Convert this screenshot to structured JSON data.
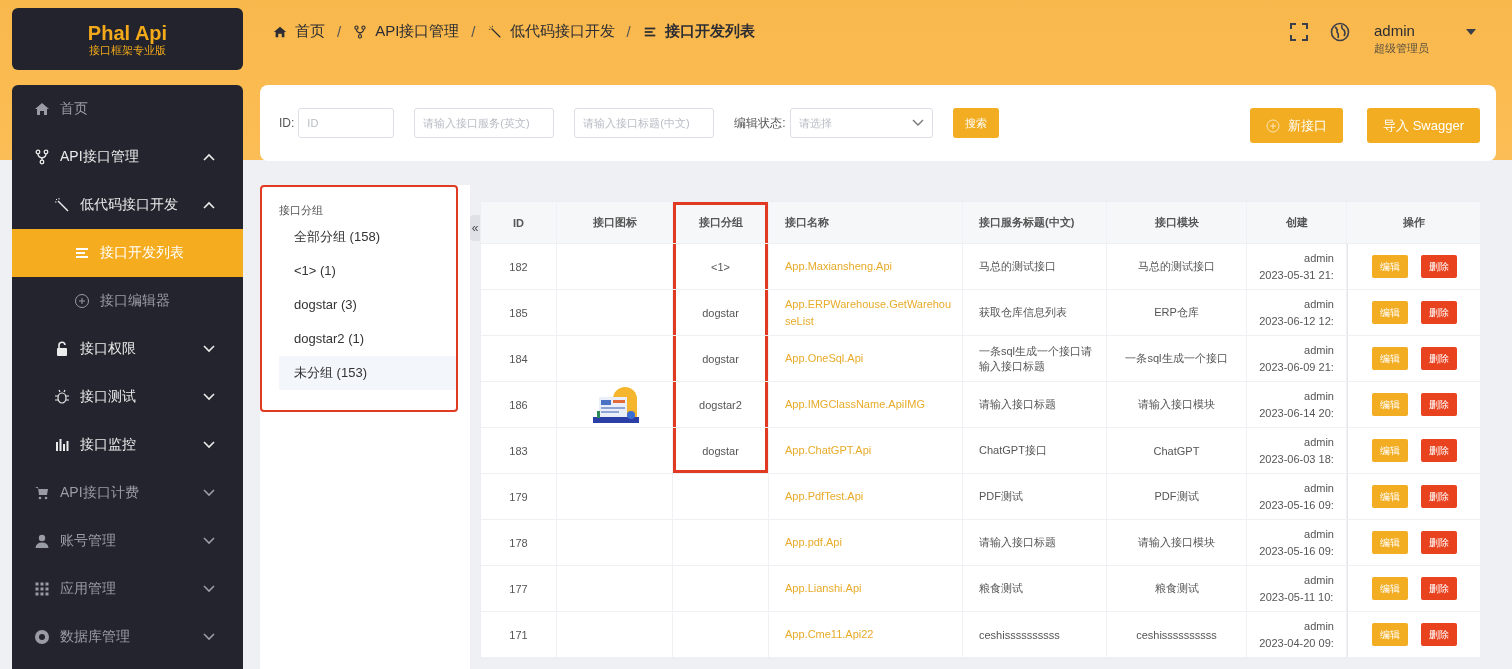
{
  "logo": {
    "name": "Phal Api",
    "tagline": "接口框架专业版"
  },
  "breadcrumb": [
    {
      "label": "首页",
      "current": false
    },
    {
      "label": "API接口管理",
      "current": false
    },
    {
      "label": "低代码接口开发",
      "current": false
    },
    {
      "label": "接口开发列表",
      "current": true
    }
  ],
  "breadcrumb_separator": "/",
  "user": {
    "name": "admin",
    "role": "超级管理员"
  },
  "sidebar": {
    "items": [
      {
        "label": "首页"
      },
      {
        "label": "API接口管理",
        "expanded": true,
        "children": [
          {
            "label": "低代码接口开发",
            "expanded": true,
            "children": [
              {
                "label": "接口开发列表",
                "selected": true
              },
              {
                "label": "接口编辑器",
                "selected": false
              }
            ]
          },
          {
            "label": "接口权限",
            "expanded": false
          },
          {
            "label": "接口测试",
            "expanded": false
          },
          {
            "label": "接口监控",
            "expanded": false
          }
        ]
      },
      {
        "label": "API接口计费",
        "expanded": false
      },
      {
        "label": "账号管理",
        "expanded": false
      },
      {
        "label": "应用管理",
        "expanded": false
      },
      {
        "label": "数据库管理",
        "expanded": false
      }
    ]
  },
  "filters": {
    "id_label": "ID:",
    "id_placeholder": "ID",
    "service_placeholder": "请输入接口服务(英文)",
    "title_placeholder": "请输入接口标题(中文)",
    "status_label": "编辑状态:",
    "status_placeholder": "请选择",
    "search_button": "搜索",
    "new_button": "新接口",
    "import_button": "导入 Swagger"
  },
  "group_panel": {
    "title": "接口分组",
    "highlighted": true,
    "items": [
      {
        "label": "全部分组 (158)",
        "selected": false
      },
      {
        "label": "<1> (1)",
        "selected": false
      },
      {
        "label": "dogstar (3)",
        "selected": false
      },
      {
        "label": "dogstar2 (1)",
        "selected": false
      },
      {
        "label": "未分组 (153)",
        "selected": true
      }
    ]
  },
  "collapse_handle": "«",
  "table": {
    "columns": [
      "ID",
      "接口图标",
      "接口分组",
      "接口名称",
      "接口服务标题(中文)",
      "接口模块",
      "创建",
      "操作"
    ],
    "group_column_highlighted": true,
    "rows": [
      {
        "id": "182",
        "group": "<1>",
        "highlighted": true,
        "name": "App.Maxiansheng.Api",
        "title": "马总的测试接口",
        "module": "马总的测试接口",
        "creator": "admin",
        "time": "2023-05-31 21:",
        "actions": [
          {
            "label": "编辑",
            "kind": "edit"
          },
          {
            "label": "删除",
            "kind": "danger"
          }
        ]
      },
      {
        "id": "185",
        "group": "dogstar",
        "highlighted": true,
        "name": "App.ERPWarehouse.GetWarehouseList",
        "title": "获取仓库信息列表",
        "module": "ERP仓库",
        "creator": "admin",
        "time": "2023-06-12 12:",
        "actions": [
          {
            "label": "编辑",
            "kind": "edit"
          },
          {
            "label": "删除",
            "kind": "danger"
          }
        ]
      },
      {
        "id": "184",
        "group": "dogstar",
        "highlighted": true,
        "name": "App.OneSql.Api",
        "title": "一条sql生成一个接口请输入接口标题",
        "module": "一条sql生成一个接口",
        "creator": "admin",
        "time": "2023-06-09 21:",
        "actions": [
          {
            "label": "编辑",
            "kind": "edit"
          },
          {
            "label": "删除",
            "kind": "danger"
          }
        ]
      },
      {
        "id": "186",
        "group": "dogstar2",
        "highlighted": true,
        "name": "App.IMGClassName.ApiIMG",
        "title": "请输入接口标题",
        "module": "请输入接口模块",
        "creator": "admin",
        "time": "2023-06-14 20:",
        "actions": [
          {
            "label": "编辑",
            "kind": "edit"
          },
          {
            "label": "删除",
            "kind": "danger"
          }
        ]
      },
      {
        "id": "183",
        "group": "dogstar",
        "highlighted": true,
        "name": "App.ChatGPT.Api",
        "title": "ChatGPT接口",
        "module": "ChatGPT",
        "creator": "admin",
        "time": "2023-06-03 18:",
        "actions": [
          {
            "label": "编辑",
            "kind": "edit"
          },
          {
            "label": "删除",
            "kind": "danger"
          }
        ]
      },
      {
        "id": "179",
        "highlighted": false,
        "name": "App.PdfTest.Api",
        "title": "PDF测试",
        "module": "PDF测试",
        "creator": "admin",
        "time": "2023-05-16 09:",
        "actions": [
          {
            "label": "编辑",
            "kind": "edit"
          },
          {
            "label": "删除",
            "kind": "danger"
          }
        ]
      },
      {
        "id": "178",
        "highlighted": false,
        "name": "App.pdf.Api",
        "title": "请输入接口标题",
        "module": "请输入接口模块",
        "creator": "admin",
        "time": "2023-05-16 09:",
        "actions": [
          {
            "label": "编辑",
            "kind": "edit"
          },
          {
            "label": "删除",
            "kind": "danger"
          }
        ]
      },
      {
        "id": "177",
        "highlighted": false,
        "name": "App.Lianshi.Api",
        "title": "粮食测试",
        "module": "粮食测试",
        "creator": "admin",
        "time": "2023-05-11 10:",
        "actions": [
          {
            "label": "编辑",
            "kind": "edit"
          },
          {
            "label": "删除",
            "kind": "danger"
          }
        ]
      },
      {
        "id": "171",
        "highlighted": false,
        "name": "App.Cme11.Api22",
        "title": "ceshissssssssss",
        "module": "ceshissssssssss",
        "creator": "admin",
        "time": "2023-04-20 09:",
        "actions": [
          {
            "label": "编辑",
            "kind": "edit"
          },
          {
            "label": "删除",
            "kind": "danger"
          }
        ]
      }
    ]
  }
}
